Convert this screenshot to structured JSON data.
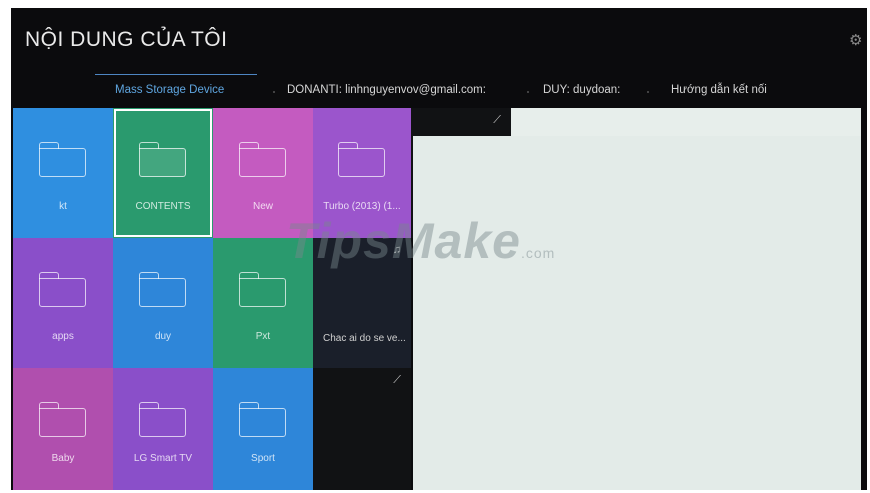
{
  "header": {
    "title": "NỘI DUNG CỦA TÔI",
    "settings_icon": "gear-icon"
  },
  "tabs": [
    {
      "label": "Mass Storage Device",
      "active": true
    },
    {
      "label": "DONANTI: linhnguyenvov@gmail.com:",
      "active": false
    },
    {
      "label": "DUY: duydoan:",
      "active": false
    },
    {
      "label": "Hướng dẫn kết nối",
      "active": false
    }
  ],
  "tiles": {
    "kt": {
      "label": "kt",
      "color": "#2f8fe0"
    },
    "contents": {
      "label": "CONTENTS",
      "color": "#2a9a6e",
      "selected": true
    },
    "new": {
      "label": "New",
      "color": "#c45bc0"
    },
    "turbo": {
      "label": "Turbo (2013) (1...",
      "color": "#9b55cc"
    },
    "apps": {
      "label": "apps",
      "color": "#8a4fc9"
    },
    "duy": {
      "label": "duy",
      "color": "#2e86d9"
    },
    "pxt": {
      "label": "Pxt",
      "color": "#2a9a6e"
    },
    "baby": {
      "label": "Baby",
      "color": "#b04fae"
    },
    "lg": {
      "label": "LG Smart TV",
      "color": "#8a4fc9"
    },
    "sport": {
      "label": "Sport",
      "color": "#2e86d9"
    }
  },
  "media": {
    "music_label": "Chac ai do se ve...",
    "music_icon": "music-note-icon",
    "video_icon": "no-preview-icon"
  },
  "watermark": {
    "text": "TipsMake",
    "suffix": ".com"
  }
}
